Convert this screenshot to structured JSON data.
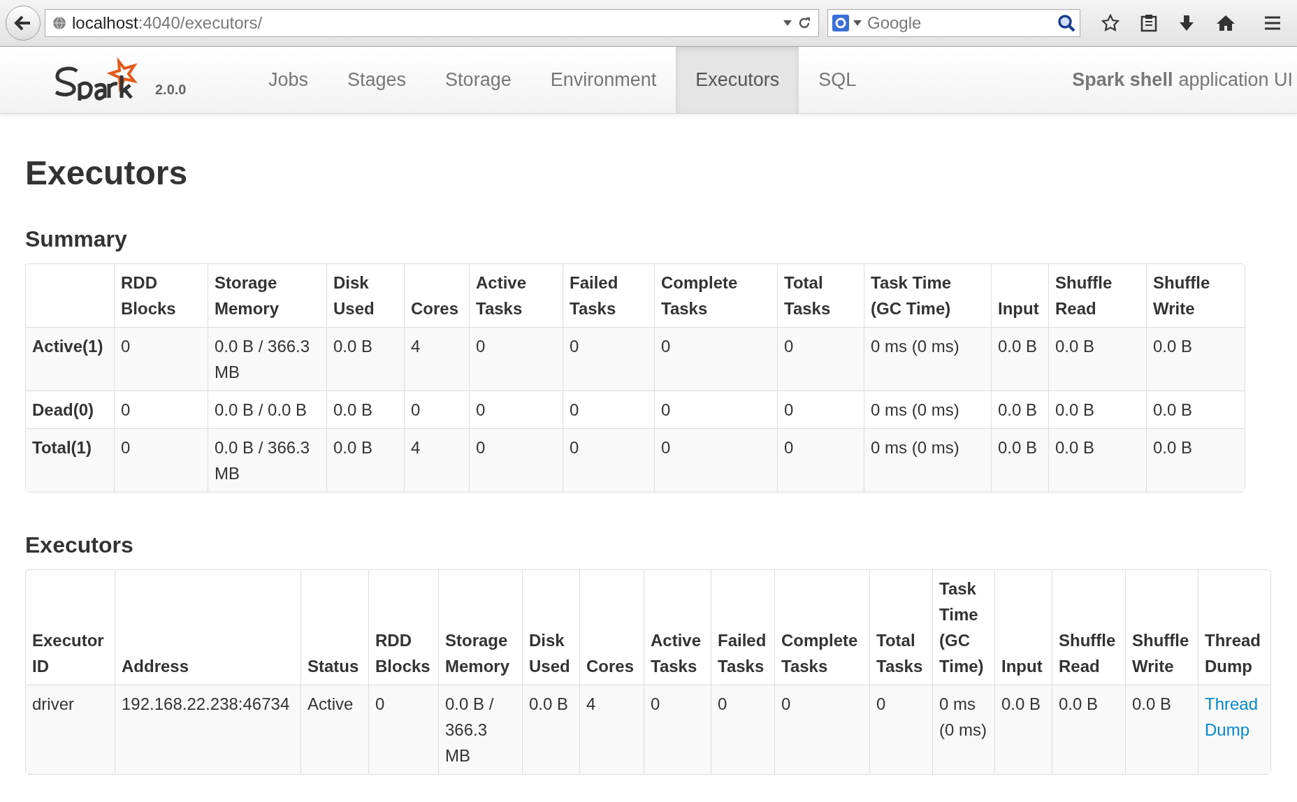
{
  "browser": {
    "url_host": "localhost",
    "url_path": ":4040/executors/",
    "search": {
      "placeholder": "Google"
    }
  },
  "navbar": {
    "version": "2.0.0",
    "tabs": [
      {
        "label": "Jobs",
        "selected": false
      },
      {
        "label": "Stages",
        "selected": false
      },
      {
        "label": "Storage",
        "selected": false
      },
      {
        "label": "Environment",
        "selected": false
      },
      {
        "label": "Executors",
        "selected": true
      },
      {
        "label": "SQL",
        "selected": false
      }
    ],
    "app_name": "Spark shell",
    "app_suffix": "application UI"
  },
  "title": "Executors",
  "summary": {
    "heading": "Summary",
    "columns": [
      "",
      "RDD Blocks",
      "Storage Memory",
      "Disk Used",
      "Cores",
      "Active Tasks",
      "Failed Tasks",
      "Complete Tasks",
      "Total Tasks",
      "Task Time (GC Time)",
      "Input",
      "Shuffle Read",
      "Shuffle Write"
    ],
    "rows": [
      [
        "Active(1)",
        "0",
        "0.0 B / 366.3 MB",
        "0.0 B",
        "4",
        "0",
        "0",
        "0",
        "0",
        "0 ms (0 ms)",
        "0.0 B",
        "0.0 B",
        "0.0 B"
      ],
      [
        "Dead(0)",
        "0",
        "0.0 B / 0.0 B",
        "0.0 B",
        "0",
        "0",
        "0",
        "0",
        "0",
        "0 ms (0 ms)",
        "0.0 B",
        "0.0 B",
        "0.0 B"
      ],
      [
        "Total(1)",
        "0",
        "0.0 B / 366.3 MB",
        "0.0 B",
        "4",
        "0",
        "0",
        "0",
        "0",
        "0 ms (0 ms)",
        "0.0 B",
        "0.0 B",
        "0.0 B"
      ]
    ]
  },
  "executors": {
    "heading": "Executors",
    "columns": [
      "Executor ID",
      "Address",
      "Status",
      "RDD Blocks",
      "Storage Memory",
      "Disk Used",
      "Cores",
      "Active Tasks",
      "Failed Tasks",
      "Complete Tasks",
      "Total Tasks",
      "Task Time (GC Time)",
      "Input",
      "Shuffle Read",
      "Shuffle Write",
      "Thread Dump"
    ],
    "rows": [
      {
        "cells": [
          "driver",
          "192.168.22.238:46734",
          "Active",
          "0",
          "0.0 B / 366.3 MB",
          "0.0 B",
          "4",
          "0",
          "0",
          "0",
          "0",
          "0 ms (0 ms)",
          "0.0 B",
          "0.0 B",
          "0.0 B"
        ],
        "link": "Thread Dump"
      }
    ]
  }
}
